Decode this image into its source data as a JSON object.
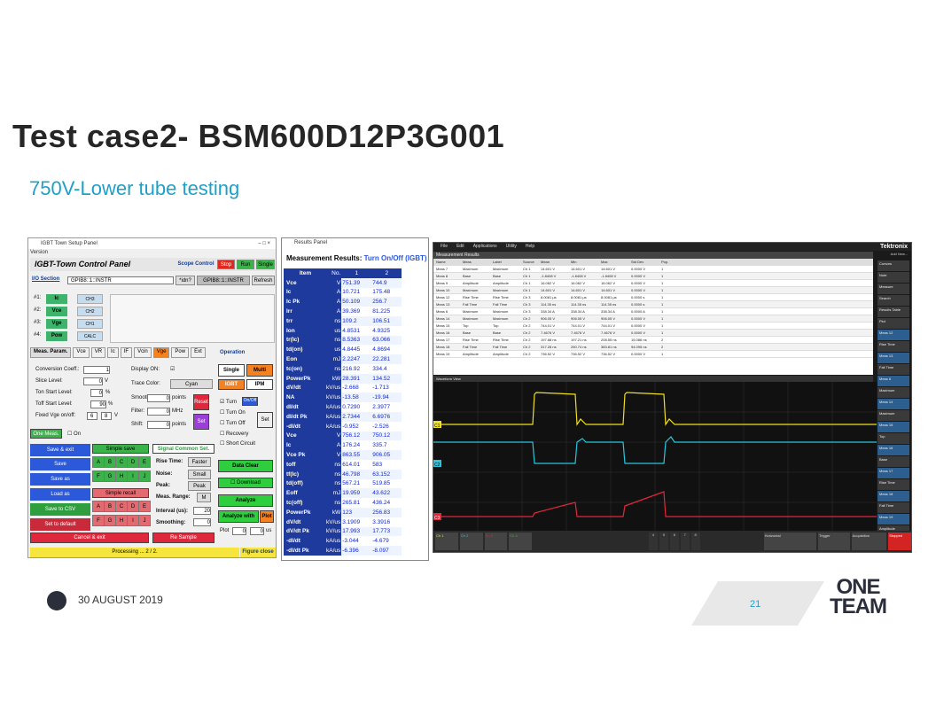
{
  "title": "Test case2- BSM600D12P3G001",
  "subtitle": "750V-Lower tube testing",
  "left": {
    "titlebar": "IGBT Town Setup Panel",
    "controls": "–    □    ×",
    "version": "Version",
    "header": "IGBT-Town Control Panel",
    "scope": "Scope Control",
    "stop": "Stop",
    "run": "Run",
    "single": "Single",
    "io": "I/O Section",
    "io_val": "GPIB8::1::INSTR",
    "idn": "*idn?",
    "io_btn": "GPIB8::1::INSTR",
    "refresh": "Refresh",
    "rows": [
      {
        "n": "#1:",
        "c": "Ic",
        "ch": "CH3"
      },
      {
        "n": "#2:",
        "c": "Vce",
        "ch": "CH2"
      },
      {
        "n": "#3:",
        "c": "Vge",
        "ch": "CH1"
      },
      {
        "n": "#4:",
        "c": "Pow",
        "ch": "CALC"
      }
    ],
    "tabs": [
      "Meas. Param.",
      "Vce",
      "VR",
      "Ic",
      "IF",
      "Vcin",
      "Vge",
      "Pow",
      "Ext"
    ],
    "operation": "Operation",
    "conv": "Conversion Coeff.:",
    "conv_v": "1",
    "disp": "Display ON:",
    "disp_v": "☑",
    "slice": "Slice Level:",
    "slice_v": "0",
    "slice_u": "V",
    "trace": "Trace Color:",
    "trace_v": "Cyan",
    "ton": "Ton Start Level:",
    "ton_v": "0",
    "ton_u": "%",
    "toff": "Toff Start Level:",
    "toff_v": "90",
    "toff_u": "%",
    "smooth": "Smooth:",
    "smooth_v": "0",
    "smooth_u": "points",
    "filter": "Filter:",
    "filter_v": "0",
    "filter_u": "MHz",
    "fixed": "Fixed Vge on/off:",
    "fixed_a": "6",
    "fixed_b": "8",
    "fixed_u": "V",
    "shift": "Shift:",
    "shift_v": "0",
    "shift_u": "points",
    "reset": "Reset",
    "set": "Set",
    "onemeas": "One Meas.",
    "on": "On",
    "singlebtn": "Single",
    "multi": "Multi",
    "igbt": "IGBT",
    "ipm": "IPM",
    "turn": "Turn",
    "onoff": "On/Off",
    "turnon": "Turn On",
    "turnoff": "Turn Off",
    "recovery": "Recovery",
    "shortc": "Short Circuit",
    "setbtn": "Set",
    "saveexit": "Save & exit",
    "simplesave": "Simple save",
    "save": "Save",
    "saveas": "Save as",
    "loadas": "Load as",
    "simplerecall": "Simple recall",
    "savecsv": "Save to CSV",
    "setdefault": "Set to default",
    "cancel": "Cancel & exit",
    "letters1": [
      "A",
      "B",
      "C",
      "D",
      "E"
    ],
    "letters2": [
      "F",
      "G",
      "H",
      "I",
      "J"
    ],
    "sigset": "Signal Common Set.",
    "rise": "Rise Time:",
    "rise_v": "Faster",
    "noise": "Noise:",
    "noise_v": "Small",
    "peak": "Peak:",
    "peak_v": "Peak",
    "range": "Meas. Range:",
    "range_v": "M",
    "interval": "Interval (us):",
    "interval_v": "20",
    "smoothing": "Smoothing:",
    "smoothing_v": "0",
    "resample": "Re Sample",
    "dataclear": "Data Clear",
    "download": "Download",
    "analyze": "Analyze",
    "awp": "Analyze with",
    "plot": "Plot",
    "plt": "Plot",
    "plt_a": "0",
    "plt_b": "0",
    "plt_u": "us",
    "processing": "Processing ... 2 / 2.",
    "figclose": "Figure close"
  },
  "mid": {
    "titlebar": "Results Panel",
    "head": "Measurement Results:",
    "mode": "Turn On/Off (IGBT)",
    "cols": [
      "Item",
      "No.",
      "1",
      "2"
    ],
    "rows": [
      [
        "Vce",
        "V",
        "751.39",
        "744.9"
      ],
      [
        "Ic",
        "A",
        "10.721",
        "175.48"
      ],
      [
        "Ic Pk",
        "A",
        "50.109",
        "256.7"
      ],
      [
        "Irr",
        "A",
        "39.369",
        "81.225"
      ],
      [
        "trr",
        "ns",
        "109.2",
        "106.51"
      ],
      [
        "Ion",
        "us",
        "4.8531",
        "4.9325"
      ],
      [
        "tr(Ic)",
        "ns",
        "8.5363",
        "63.066"
      ],
      [
        "td(on)",
        "us",
        "4.8445",
        "4.8694"
      ],
      [
        "Eon",
        "mJ",
        "2.2247",
        "22.281"
      ],
      [
        "tc(on)",
        "ns",
        "216.92",
        "334.4"
      ],
      [
        "PowerPk",
        "kW",
        "28.391",
        "134.52"
      ],
      [
        "dV/dt",
        "kV/us",
        "-2.668",
        "-1.713"
      ],
      [
        "NA",
        "kV/us",
        "-13.58",
        "-19.94"
      ],
      [
        "dI/dt",
        "kA/us",
        "0.7290",
        "2.3977"
      ],
      [
        "dI/dt Pk",
        "kA/us",
        "2.7344",
        "6.6976"
      ],
      [
        "-dI/dt",
        "kA/us",
        "-0.952",
        "-2.526"
      ],
      [
        "Vce",
        "V",
        "756.12",
        "750.12"
      ],
      [
        "Ic",
        "A",
        "176.24",
        "335.7"
      ],
      [
        "Vce Pk",
        "V",
        "863.55",
        "906.05"
      ],
      [
        "toff",
        "ns",
        "614.01",
        "583"
      ],
      [
        "tf(Ic)",
        "ns",
        "46.798",
        "63.152"
      ],
      [
        "td(off)",
        "ns",
        "567.21",
        "519.85"
      ],
      [
        "Eoff",
        "mJ",
        "19.959",
        "43.622"
      ],
      [
        "tc(off)",
        "ns",
        "265.81",
        "436.24"
      ],
      [
        "PowerPk",
        "kW",
        "123",
        "256.83"
      ],
      [
        "dV/dt",
        "kV/us",
        "3.1909",
        "3.3916"
      ],
      [
        "dV/dt Pk",
        "kV/us",
        "17.993",
        "17.773"
      ],
      [
        "-dI/dt",
        "kA/us",
        "-3.044",
        "-4.679"
      ],
      [
        "-dI/dt Pk",
        "kA/us",
        "-6.396",
        "-8.097"
      ]
    ]
  },
  "right": {
    "menu": [
      "File",
      "Edit",
      "Applications",
      "Utility",
      "Help"
    ],
    "brand": "Tektronix",
    "addnew": "Add New...",
    "mr": "Measurement Results",
    "wv": "Waveform View",
    "cols": [
      "Name",
      "Meas",
      "Label",
      "Source",
      "Mean",
      "Min",
      "Max",
      "Std Dev",
      "Pop."
    ],
    "rows": [
      [
        "Meas 7",
        "Maximum",
        "Maximum",
        "Ch 1",
        "14.601 V",
        "14.601 V",
        "14.601 V",
        "0.0000 V",
        "1"
      ],
      [
        "Meas 8",
        "Base",
        "Base",
        "Ch 1",
        "-1.8408 V",
        "-1.8408 V",
        "-1.8408 V",
        "0.0000 V",
        "1"
      ],
      [
        "Meas 9",
        "Amplitude",
        "Amplitude",
        "Ch 1",
        "16.062 V",
        "16.062 V",
        "16.062 V",
        "0.0000 V",
        "1"
      ],
      [
        "Meas 10",
        "Maximum",
        "Maximum",
        "Ch 1",
        "14.601 V",
        "14.601 V",
        "14.601 V",
        "0.0000 V",
        "1"
      ],
      [
        "Meas 12",
        "Rise Time",
        "Rise Time",
        "Ch 3",
        "8.0081 μs",
        "8.0081 μs",
        "8.0081 μs",
        "0.0000 s",
        "1"
      ],
      [
        "Meas 13",
        "Fall Time",
        "Fall Time",
        "Ch 3",
        "114.35 ns",
        "114.35 ns",
        "114.35 ns",
        "0.0000 s",
        "1"
      ],
      [
        "Meas 6",
        "Maximum",
        "Maximum",
        "Ch 3",
        "338.34 A",
        "338.34 A",
        "338.34 A",
        "0.0000 A",
        "1"
      ],
      [
        "Meas 14",
        "Maximum",
        "Maximum",
        "Ch 2",
        "906.05 V",
        "906.05 V",
        "906.05 V",
        "0.0000 V",
        "1"
      ],
      [
        "Meas 15",
        "Top",
        "Top",
        "Ch 2",
        "744.01 V",
        "744.01 V",
        "744.01 V",
        "0.0000 V",
        "1"
      ],
      [
        "Meas 16",
        "Base",
        "Base",
        "Ch 2",
        "7.4676 V",
        "7.4676 V",
        "7.4676 V",
        "0.0000 V",
        "1"
      ],
      [
        "Meas 17",
        "Rise Time",
        "Rise Time",
        "Ch 2",
        "197.88 ns",
        "197.21 ns",
        "208.55 ns",
        "15.086 ns",
        "2"
      ],
      [
        "Meas 18",
        "Fall Time",
        "Fall Time",
        "Ch 2",
        "317.28 ns",
        "250.74 ns",
        "383.81 ns",
        "94.095 ns",
        "2"
      ],
      [
        "Meas 19",
        "Amplitude",
        "Amplitude",
        "Ch 2",
        "736.52 V",
        "736.52 V",
        "736.52 V",
        "0.0000 V",
        "1"
      ]
    ],
    "side": [
      "Cursors",
      "Note",
      "Measure",
      "Search",
      "Results Table",
      "Plot",
      "Meas 12",
      "Rise Time",
      "Meas 13",
      "Fall Time",
      "Meas 6",
      "Maximum",
      "Meas 14",
      "Maximum",
      "Meas 15",
      "Top",
      "Meas 16",
      "Base",
      "Meas 17",
      "Rise Time",
      "Meas 18",
      "Fall Time",
      "Meas 19",
      "Amplitude"
    ],
    "bottom": [
      "Ch 1",
      "Ch 2",
      "Ch 3",
      "Ch 4",
      "Horizontal",
      "Trigger",
      "Acquisition",
      "Stopped"
    ],
    "nums": [
      "4",
      "5",
      "6",
      "7",
      "8"
    ],
    "ch_labels": [
      "C1",
      "C2",
      "C3"
    ]
  },
  "footer": {
    "date": "30 AUGUST 2019",
    "page": "21",
    "one": "ONE",
    "team": "TEAM"
  }
}
